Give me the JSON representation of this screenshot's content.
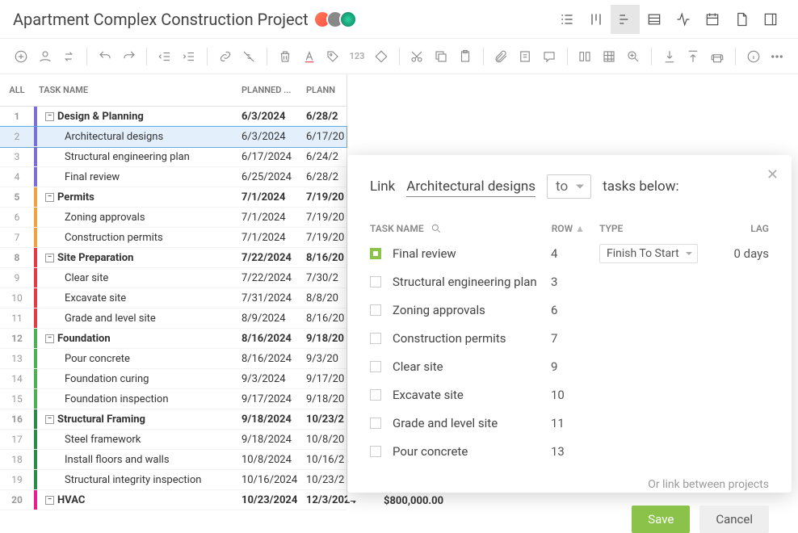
{
  "header": {
    "title": "Apartment Complex Construction Project"
  },
  "grid": {
    "headers": {
      "all": "ALL",
      "name": "TASK NAME",
      "planned1": "PLANNED ...",
      "planned2": "PLANN"
    },
    "rows": [
      {
        "num": "1",
        "name": "Design & Planning",
        "d1": "6/3/2024",
        "d2": "6/28/2",
        "group": true,
        "color": "#7a6fd8"
      },
      {
        "num": "2",
        "name": "Architectural designs",
        "d1": "6/3/2024",
        "d2": "6/17/20",
        "group": false,
        "color": "#7a6fd8",
        "selected": true
      },
      {
        "num": "3",
        "name": "Structural engineering plan",
        "d1": "6/17/2024",
        "d2": "6/24/2",
        "group": false,
        "color": "#7a6fd8"
      },
      {
        "num": "4",
        "name": "Final review",
        "d1": "6/25/2024",
        "d2": "6/28/2",
        "group": false,
        "color": "#7a6fd8"
      },
      {
        "num": "5",
        "name": "Permits",
        "d1": "7/1/2024",
        "d2": "7/19/20",
        "group": true,
        "color": "#f2a23c"
      },
      {
        "num": "6",
        "name": "Zoning approvals",
        "d1": "7/1/2024",
        "d2": "7/19/20",
        "group": false,
        "color": "#f2a23c"
      },
      {
        "num": "7",
        "name": "Construction permits",
        "d1": "7/1/2024",
        "d2": "7/19/20",
        "group": false,
        "color": "#f2a23c"
      },
      {
        "num": "8",
        "name": "Site Preparation",
        "d1": "7/22/2024",
        "d2": "8/16/20",
        "group": true,
        "color": "#e53946"
      },
      {
        "num": "9",
        "name": "Clear site",
        "d1": "7/22/2024",
        "d2": "7/30/2",
        "group": false,
        "color": "#e53946"
      },
      {
        "num": "10",
        "name": "Excavate site",
        "d1": "7/31/2024",
        "d2": "8/8/20",
        "group": false,
        "color": "#e53946"
      },
      {
        "num": "11",
        "name": "Grade and level site",
        "d1": "8/9/2024",
        "d2": "8/16/20",
        "group": false,
        "color": "#e53946"
      },
      {
        "num": "12",
        "name": "Foundation",
        "d1": "8/16/2024",
        "d2": "9/18/20",
        "group": true,
        "color": "#4caf50"
      },
      {
        "num": "13",
        "name": "Pour concrete",
        "d1": "8/16/2024",
        "d2": "9/3/20",
        "group": false,
        "color": "#4caf50"
      },
      {
        "num": "14",
        "name": "Foundation curing",
        "d1": "9/3/2024",
        "d2": "9/17/20",
        "group": false,
        "color": "#4caf50"
      },
      {
        "num": "15",
        "name": "Foundation inspection",
        "d1": "9/17/2024",
        "d2": "9/18/20",
        "group": false,
        "color": "#4caf50"
      },
      {
        "num": "16",
        "name": "Structural Framing",
        "d1": "9/18/2024",
        "d2": "10/23/2",
        "group": true,
        "color": "#2a8a4a"
      },
      {
        "num": "17",
        "name": "Steel framework",
        "d1": "9/18/2024",
        "d2": "10/8/20",
        "group": false,
        "color": "#2a8a4a"
      },
      {
        "num": "18",
        "name": "Install floors and walls",
        "d1": "10/8/2024",
        "d2": "10/16/2",
        "group": false,
        "color": "#2a8a4a"
      },
      {
        "num": "19",
        "name": "Structural integrity inspection",
        "d1": "10/16/2024",
        "d2": "10/23/2",
        "group": false,
        "color": "#2a8a4a"
      },
      {
        "num": "20",
        "name": "HVAC",
        "d1": "10/23/2024",
        "d2": "12/3/2024",
        "group": true,
        "color": "#e91e8c"
      }
    ]
  },
  "dialog": {
    "label_link": "Link",
    "task_name": "Architectural designs",
    "direction": "to",
    "label_tasks_below": "tasks below:",
    "headers": {
      "name": "TASK NAME",
      "row": "ROW",
      "type": "TYPE",
      "lag": "LAG"
    },
    "rows": [
      {
        "checked": true,
        "name": "Final review",
        "row": "4",
        "type": "Finish To Start",
        "lag": "0 days"
      },
      {
        "checked": false,
        "name": "Structural engineering plan",
        "row": "3"
      },
      {
        "checked": false,
        "name": "Zoning approvals",
        "row": "6"
      },
      {
        "checked": false,
        "name": "Construction permits",
        "row": "7"
      },
      {
        "checked": false,
        "name": "Clear site",
        "row": "9"
      },
      {
        "checked": false,
        "name": "Excavate site",
        "row": "10"
      },
      {
        "checked": false,
        "name": "Grade and level site",
        "row": "11"
      },
      {
        "checked": false,
        "name": "Pour concrete",
        "row": "13"
      }
    ],
    "link_between": "Or link between projects",
    "save": "Save",
    "cancel": "Cancel"
  },
  "price": "$800,000.00"
}
